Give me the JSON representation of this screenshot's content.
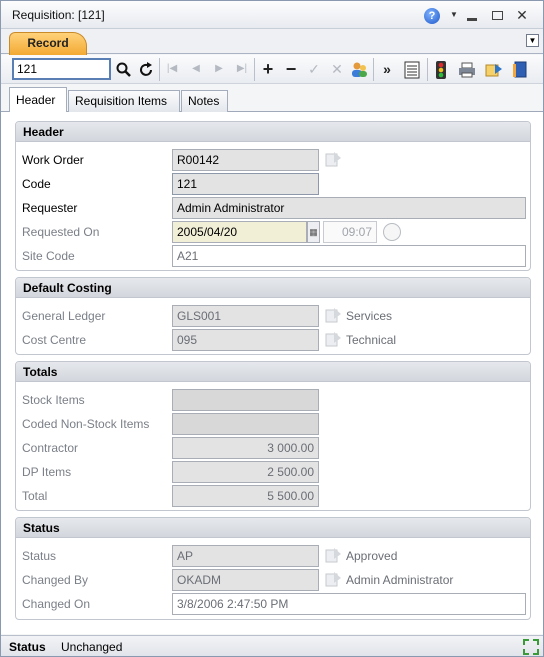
{
  "window": {
    "title": "Requisition: [121]"
  },
  "record_tab": {
    "label": "Record"
  },
  "toolbar": {
    "search_value": "121",
    "icons": [
      "search-icon",
      "refresh-icon",
      "first-icon",
      "previous-icon",
      "next-icon",
      "last-icon",
      "add-icon",
      "remove-icon",
      "accept-icon",
      "cancel-icon",
      "users-icon",
      "more-icon",
      "list-icon",
      "traffic-light-icon",
      "print-icon",
      "export-icon",
      "book-icon"
    ]
  },
  "subtabs": [
    {
      "label": "Header",
      "active": true
    },
    {
      "label": "Requisition Items",
      "active": false
    },
    {
      "label": "Notes",
      "active": false
    }
  ],
  "header_group": {
    "title": "Header",
    "work_order_label": "Work Order",
    "work_order_value": "R00142",
    "code_label": "Code",
    "code_value": "121",
    "requester_label": "Requester",
    "requester_value": "Admin Administrator",
    "requested_on_label": "Requested On",
    "requested_on_date": "2005/04/20",
    "requested_on_time": "09:07",
    "site_code_label": "Site Code",
    "site_code_value": "A21"
  },
  "costing_group": {
    "title": "Default Costing",
    "gl_label": "General Ledger",
    "gl_value": "GLS001",
    "gl_desc": "Services",
    "cc_label": "Cost Centre",
    "cc_value": "095",
    "cc_desc": "Technical"
  },
  "totals_group": {
    "title": "Totals",
    "stock_label": "Stock Items",
    "stock_value": "",
    "coded_label": "Coded Non-Stock Items",
    "coded_value": "",
    "contractor_label": "Contractor",
    "contractor_value": "3 000.00",
    "dp_label": "DP Items",
    "dp_value": "2 500.00",
    "total_label": "Total",
    "total_value": "5 500.00"
  },
  "status_group": {
    "title": "Status",
    "status_label": "Status",
    "status_value": "AP",
    "status_desc": "Approved",
    "changed_by_label": "Changed By",
    "changed_by_value": "OKADM",
    "changed_by_desc": "Admin Administrator",
    "changed_on_label": "Changed On",
    "changed_on_value": "3/8/2006 2:47:50 PM"
  },
  "statusbar": {
    "label": "Status",
    "value": "Unchanged"
  }
}
